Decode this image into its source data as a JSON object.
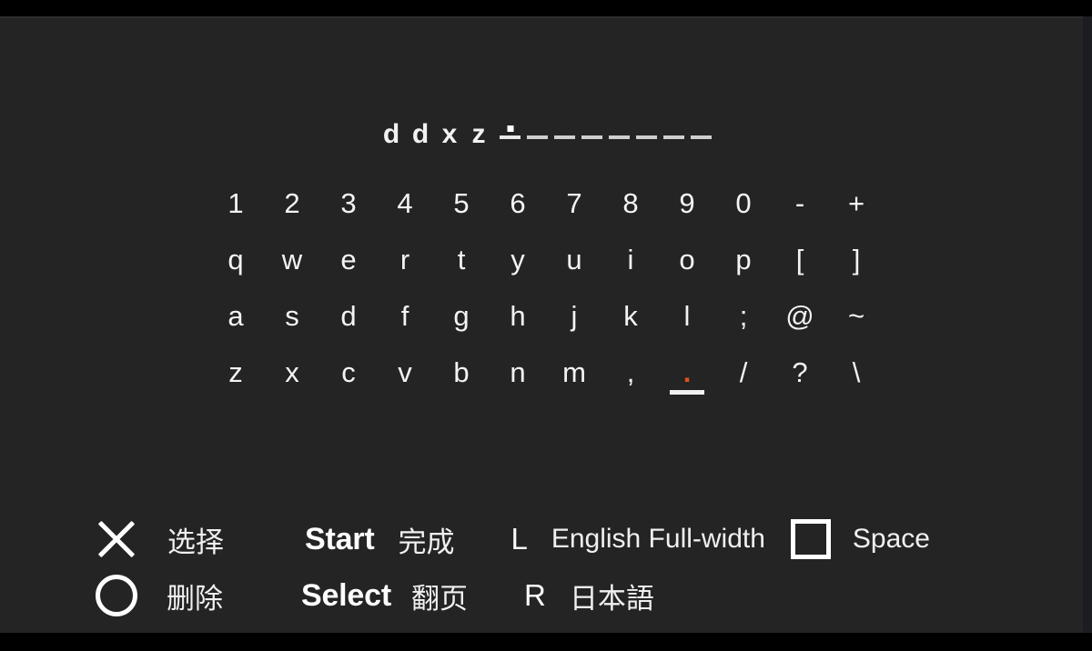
{
  "theme": {
    "background": "#242424",
    "letterbox": "#000000",
    "text": "#f2f2f2",
    "highlight": "#e0511c"
  },
  "input_field": {
    "committed_text": [
      "d",
      "d",
      "x",
      "z"
    ],
    "slot_count": 8,
    "cursor_slot_index": 0,
    "caret_glyph": "caret-dot"
  },
  "keyboard": {
    "rows": [
      {
        "keys": [
          "1",
          "2",
          "3",
          "4",
          "5",
          "6",
          "7",
          "8",
          "9",
          "0",
          "-",
          "+"
        ]
      },
      {
        "keys": [
          "q",
          "w",
          "e",
          "r",
          "t",
          "y",
          "u",
          "i",
          "o",
          "p",
          "[",
          "]"
        ]
      },
      {
        "keys": [
          "a",
          "s",
          "d",
          "f",
          "g",
          "h",
          "j",
          "k",
          "l",
          ";",
          "@",
          "~"
        ]
      },
      {
        "keys": [
          "z",
          "x",
          "c",
          "v",
          "b",
          "n",
          "m",
          ",",
          ".",
          "/",
          "?",
          "\\"
        ]
      }
    ],
    "selected": {
      "row": 3,
      "col": 8,
      "key": "."
    }
  },
  "legend": {
    "row1": [
      {
        "icon": "cross-button-icon",
        "label": "选择"
      },
      {
        "button": "Start",
        "label": "完成"
      },
      {
        "key": "L",
        "label": "English Full-width"
      },
      {
        "icon": "square-button-icon",
        "label": "Space"
      }
    ],
    "row2": [
      {
        "icon": "circle-button-icon",
        "label": "删除"
      },
      {
        "button": "Select",
        "label": "翻页"
      },
      {
        "key": "R",
        "label": "日本語"
      }
    ]
  }
}
